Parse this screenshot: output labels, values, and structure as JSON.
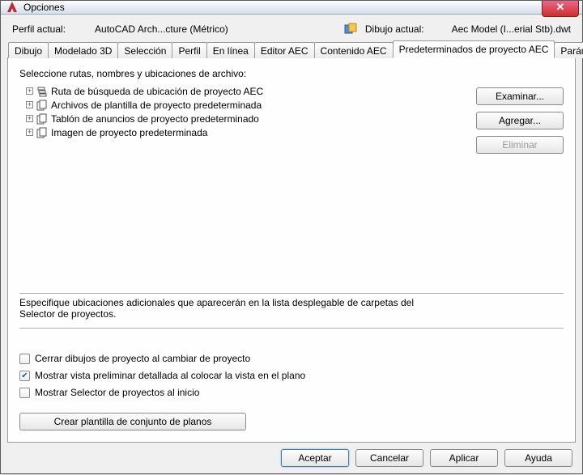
{
  "window": {
    "title": "Opciones"
  },
  "profile": {
    "label": "Perfil actual:",
    "value": "AutoCAD Arch...cture (Métrico)",
    "drawing_label": "Dibujo actual:",
    "drawing_value": "Aec Model (I...erial Stb).dwt"
  },
  "tabs": {
    "items": [
      "Dibujo",
      "Modelado 3D",
      "Selección",
      "Perfil",
      "En línea",
      "Editor AEC",
      "Contenido AEC",
      "Predeterminados de proyecto AEC",
      "Parámetros d"
    ],
    "active_index": 7
  },
  "page": {
    "section_label": "Seleccione rutas, nombres y ubicaciones de archivo:",
    "tree": [
      "Ruta de búsqueda de ubicación de proyecto AEC",
      "Archivos de plantilla de proyecto predeterminada",
      "Tablón de anuncios de proyecto predeterminado",
      "Imagen de proyecto predeterminada"
    ],
    "side_buttons": {
      "browse": "Examinar...",
      "add": "Agregar...",
      "delete": "Eliminar"
    },
    "desc": "Especifique ubicaciones adicionales que aparecerán en la lista desplegable de carpetas del Selector de proyectos.",
    "checks": {
      "close_drawings": "Cerrar dibujos de proyecto al cambiar de proyecto",
      "show_preview": "Mostrar vista preliminar detallada al colocar la vista en el plano",
      "show_selector": "Mostrar Selector de proyectos al inicio"
    },
    "create_template": "Crear plantilla de conjunto de planos"
  },
  "buttons": {
    "ok": "Aceptar",
    "cancel": "Cancelar",
    "apply": "Aplicar",
    "help": "Ayuda"
  }
}
